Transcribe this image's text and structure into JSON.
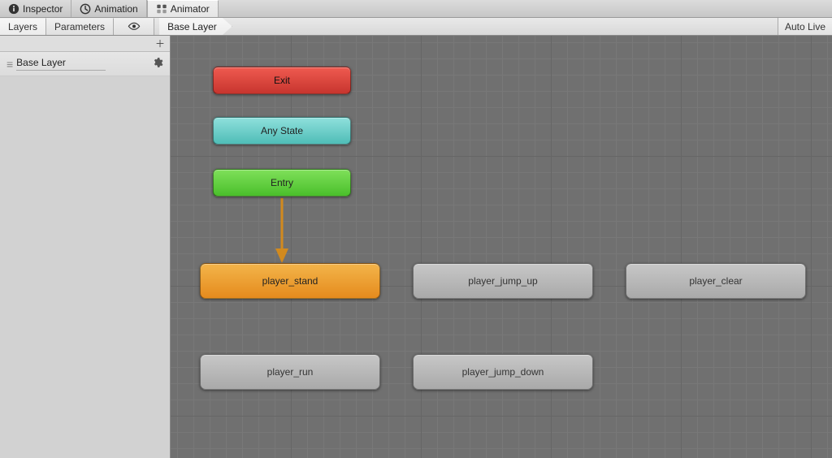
{
  "tabs": {
    "inspector": "Inspector",
    "animation": "Animation",
    "animator": "Animator"
  },
  "subtabs": {
    "layers": "Layers",
    "parameters": "Parameters"
  },
  "breadcrumb": "Base Layer",
  "auto_live": "Auto Live",
  "sidebar": {
    "layer_name": "Base Layer"
  },
  "nodes": {
    "exit": "Exit",
    "any_state": "Any State",
    "entry": "Entry",
    "player_stand": "player_stand",
    "player_jump_up": "player_jump_up",
    "player_clear": "player_clear",
    "player_run": "player_run",
    "player_jump_down": "player_jump_down"
  }
}
